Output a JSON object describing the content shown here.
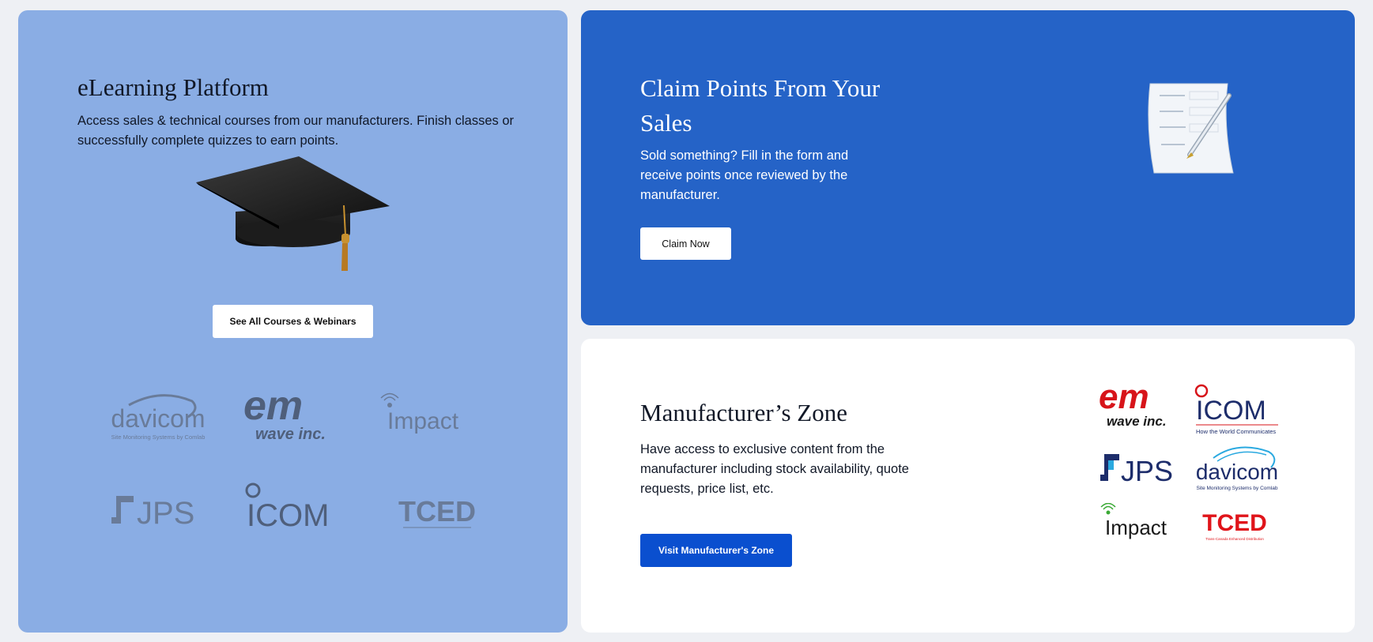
{
  "elearning": {
    "title": "eLearning Platform",
    "description": "Access sales & technical courses from our manufacturers. Finish classes or successfully complete quizzes to earn points.",
    "button_label": "See All Courses & Webinars",
    "logos": [
      {
        "name": "davicom",
        "text": "davicom",
        "subtext": "Site Monitoring Systems by Comlab"
      },
      {
        "name": "em-wave",
        "text": "em",
        "subtext": "wave inc."
      },
      {
        "name": "impact",
        "text": "Impact"
      },
      {
        "name": "jps",
        "text": "JPS"
      },
      {
        "name": "icom",
        "text": "ICOM"
      },
      {
        "name": "tced",
        "text": "TCED"
      }
    ]
  },
  "claim": {
    "title": "Claim Points From Your Sales",
    "description": "Sold something? Fill in the form and receive points once reviewed by the manufacturer.",
    "button_label": "Claim Now"
  },
  "manufacturer": {
    "title": "Manufacturer’s Zone",
    "description": "Have access to exclusive content from the manufacturer including stock availability, quote requests, price list, etc.",
    "button_label": "Visit Manufacturer's Zone",
    "logos": [
      {
        "name": "em-wave",
        "text": "em",
        "subtext": "wave inc."
      },
      {
        "name": "icom",
        "text": "ICOM",
        "subtext": "How the World Communicates"
      },
      {
        "name": "jps",
        "text": "JPS"
      },
      {
        "name": "davicom",
        "text": "davicom",
        "subtext": "Site Monitoring Systems by Comlab"
      },
      {
        "name": "impact",
        "text": "Impact"
      },
      {
        "name": "tced",
        "text": "TCED",
        "subtext": "Trans-Canada Enhanced Distribution"
      }
    ]
  },
  "colors": {
    "page_bg": "#eef0f4",
    "elearning_bg": "#8aade4",
    "claim_bg": "#2563c7",
    "manufacturer_bg": "#ffffff",
    "primary_button": "#0a4fcf",
    "logo_red": "#d7141a",
    "logo_navy": "#1d2d6b",
    "logo_cyan": "#2aa9e0",
    "logo_green": "#3aa935"
  }
}
